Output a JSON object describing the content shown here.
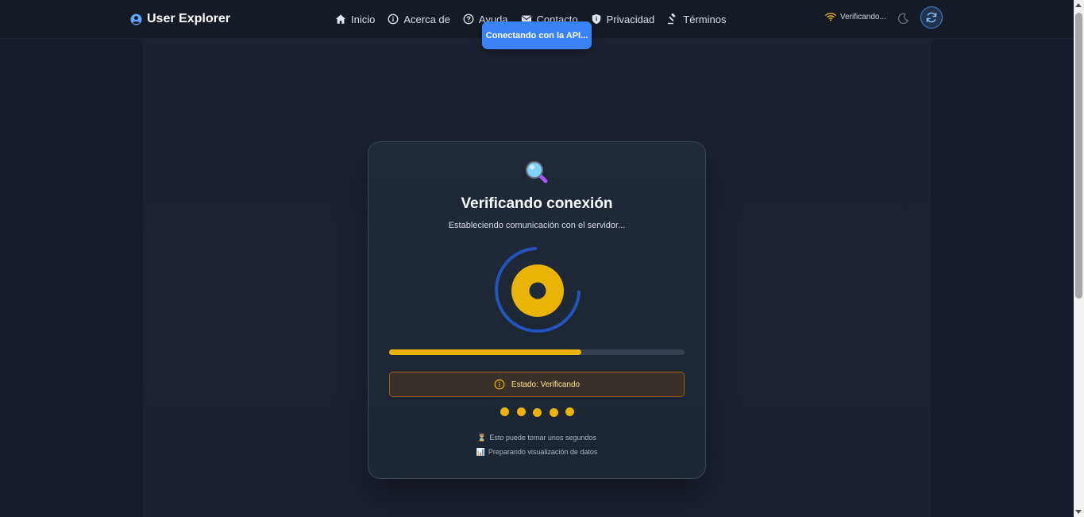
{
  "app": {
    "brand": "User Explorer"
  },
  "nav": {
    "items": [
      {
        "label": "Inicio",
        "icon": "home-icon"
      },
      {
        "label": "Acerca de",
        "icon": "info-icon"
      },
      {
        "label": "Ayuda",
        "icon": "help-icon"
      },
      {
        "label": "Contacto",
        "icon": "mail-icon"
      },
      {
        "label": "Privacidad",
        "icon": "shield-icon"
      },
      {
        "label": "Términos",
        "icon": "gavel-icon"
      }
    ]
  },
  "status": {
    "label": "Verificando...",
    "icon": "wifi-icon",
    "color": "#eab308"
  },
  "toast": {
    "message": "Conectando con la API..."
  },
  "card": {
    "emoji": "magnifier-icon",
    "title": "Verificando conexión",
    "subtitle": "Estableciendo comunicación con el servidor...",
    "progress": 0.65,
    "alert": "Estado: Verificando",
    "dots_count": 5,
    "notes": [
      {
        "glyph": "⏳",
        "text": "Esto puede tomar unos segundos"
      },
      {
        "glyph": "📊",
        "text": "Preparando visualización de datos"
      }
    ]
  },
  "colors": {
    "accent_blue": "#3b82f6",
    "accent_yellow": "#eab308",
    "background": "#161d2a"
  }
}
